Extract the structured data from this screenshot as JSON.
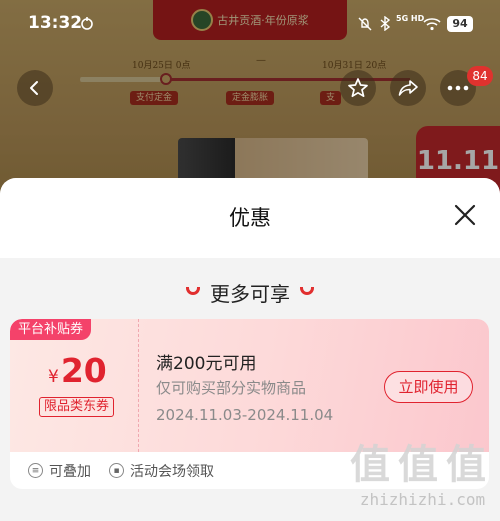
{
  "status_bar": {
    "time": "13:32",
    "network": "5G HD",
    "battery": "94"
  },
  "background_page": {
    "banner_text": "古井贡酒·年份原浆",
    "timeline": {
      "start_date": "10月25日 0点",
      "end_date": "10月31日 20点",
      "dash": "—",
      "steps": [
        "支付定金",
        "定金膨胀",
        "支"
      ]
    },
    "cart_badge": "84",
    "mi_logo": "11.11"
  },
  "sheet": {
    "title": "优惠",
    "section_title": "更多可享"
  },
  "coupon": {
    "tag": "平台补贴券",
    "currency": "¥",
    "amount": "20",
    "category": "限品类东券",
    "condition": "满200元可用",
    "scope": "仅可购买部分实物商品",
    "valid_dates": "2024.11.03-2024.11.04",
    "use_button": "立即使用",
    "features": [
      {
        "label": "可叠加",
        "icon": "stack-icon"
      },
      {
        "label": "活动会场领取",
        "icon": "venue-icon"
      }
    ]
  },
  "watermark": {
    "text": "zhizhizhi.com"
  },
  "colors": {
    "accent": "#e0232f",
    "tag_pink": "#f4426a",
    "sheet_bg": "#f3f3f3"
  }
}
